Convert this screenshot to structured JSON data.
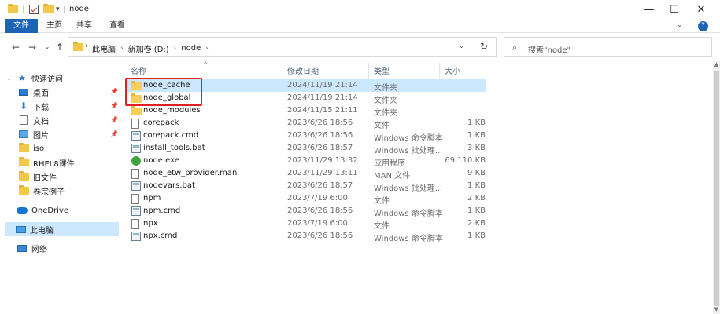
{
  "window": {
    "title": "node"
  },
  "ribbon": {
    "tabs": [
      "文件",
      "主页",
      "共享",
      "查看"
    ]
  },
  "address": {
    "crumbs": [
      "此电脑",
      "新加卷 (D:)",
      "node"
    ],
    "search_placeholder": "搜索\"node\""
  },
  "nav": {
    "quick_access": "快速访问",
    "items": [
      "桌面",
      "下载",
      "文档",
      "图片",
      "iso",
      "RHEL8课件",
      "旧文件",
      "卷宗例子"
    ],
    "onedrive": "OneDrive",
    "thispc": "此电脑",
    "network": "网络"
  },
  "columns": {
    "name": "名称",
    "date": "修改日期",
    "type": "类型",
    "size": "大小"
  },
  "files": [
    {
      "name": "node_cache",
      "date": "2024/11/19 21:14",
      "type": "文件夹",
      "size": "",
      "icon": "folder"
    },
    {
      "name": "node_global",
      "date": "2024/11/19 21:14",
      "type": "文件夹",
      "size": "",
      "icon": "folder"
    },
    {
      "name": "node_modules",
      "date": "2024/11/15 21:11",
      "type": "文件夹",
      "size": "",
      "icon": "folder"
    },
    {
      "name": "corepack",
      "date": "2023/6/26 18:56",
      "type": "文件",
      "size": "1 KB",
      "icon": "file"
    },
    {
      "name": "corepack.cmd",
      "date": "2023/6/26 18:56",
      "type": "Windows 命令脚本",
      "size": "1 KB",
      "icon": "cmd"
    },
    {
      "name": "install_tools.bat",
      "date": "2023/6/26 18:57",
      "type": "Windows 批处理...",
      "size": "3 KB",
      "icon": "cmd"
    },
    {
      "name": "node.exe",
      "date": "2023/11/29 13:32",
      "type": "应用程序",
      "size": "69,110 KB",
      "icon": "exe"
    },
    {
      "name": "node_etw_provider.man",
      "date": "2023/11/29 13:11",
      "type": "MAN 文件",
      "size": "9 KB",
      "icon": "file"
    },
    {
      "name": "nodevars.bat",
      "date": "2023/6/26 18:57",
      "type": "Windows 批处理...",
      "size": "1 KB",
      "icon": "cmd"
    },
    {
      "name": "npm",
      "date": "2023/7/19 6:00",
      "type": "文件",
      "size": "2 KB",
      "icon": "file"
    },
    {
      "name": "npm.cmd",
      "date": "2023/6/26 18:56",
      "type": "Windows 命令脚本",
      "size": "1 KB",
      "icon": "cmd"
    },
    {
      "name": "npx",
      "date": "2023/7/19 6:00",
      "type": "文件",
      "size": "2 KB",
      "icon": "file"
    },
    {
      "name": "npx.cmd",
      "date": "2023/6/26 18:56",
      "type": "Windows 命令脚本",
      "size": "1 KB",
      "icon": "cmd"
    }
  ],
  "colors": {
    "accent": "#1d63b6",
    "selected": "#cce8ff",
    "highlight_box": "#e02020"
  }
}
